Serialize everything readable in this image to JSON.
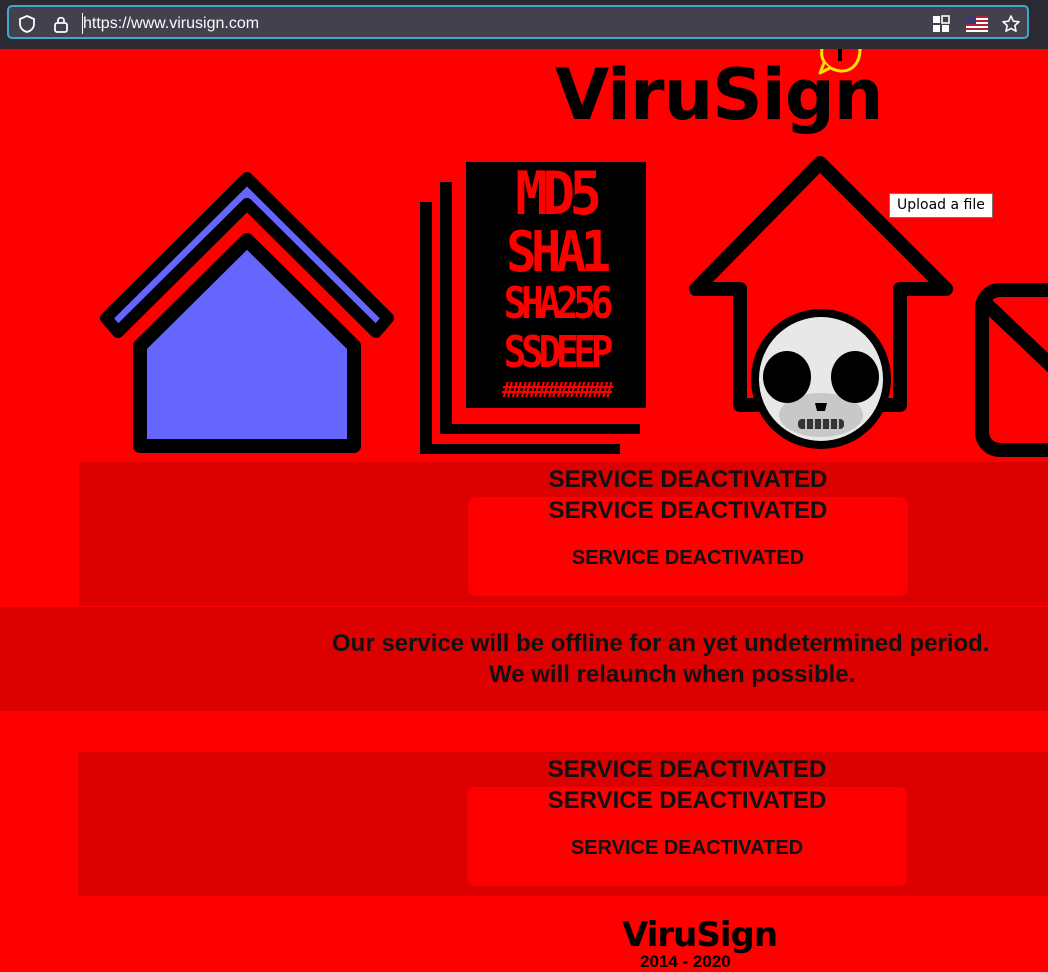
{
  "browser": {
    "url": "https://www.virusign.com",
    "icons": [
      "shield-icon",
      "lock-icon",
      "qr-grid-icon",
      "us-flag-icon",
      "bookmark-star-icon"
    ]
  },
  "site": {
    "logo": "ViruSign",
    "logo_badge_icon": "chat-bubble-icon"
  },
  "nav": {
    "home_icon": "home-icon",
    "hashes": [
      "MD5",
      "SHA1",
      "SHA256",
      "SSDEEP",
      "############"
    ],
    "upload_icon": "upload-skull-icon",
    "mail_icon": "mail-icon",
    "upload_tooltip": "Upload a file"
  },
  "panels": [
    {
      "line1": "SERVICE DEACTIVATED",
      "line2": "SERVICE DEACTIVATED",
      "line3": "SERVICE DEACTIVATED"
    },
    {
      "line1": "SERVICE DEACTIVATED",
      "line2": "SERVICE DEACTIVATED",
      "line3": "SERVICE DEACTIVATED"
    }
  ],
  "notice": {
    "line1": "Our service will be offline for an yet undetermined period.",
    "line2": "We will relaunch when possible."
  },
  "footer": {
    "logo": "ViruSign",
    "years": "2014 - 2020"
  },
  "colors": {
    "page_bg": "#ff0000",
    "panel_bg": "#dd0000",
    "home_fill": "#6666ff",
    "url_focus_border": "#3fa7c7"
  }
}
